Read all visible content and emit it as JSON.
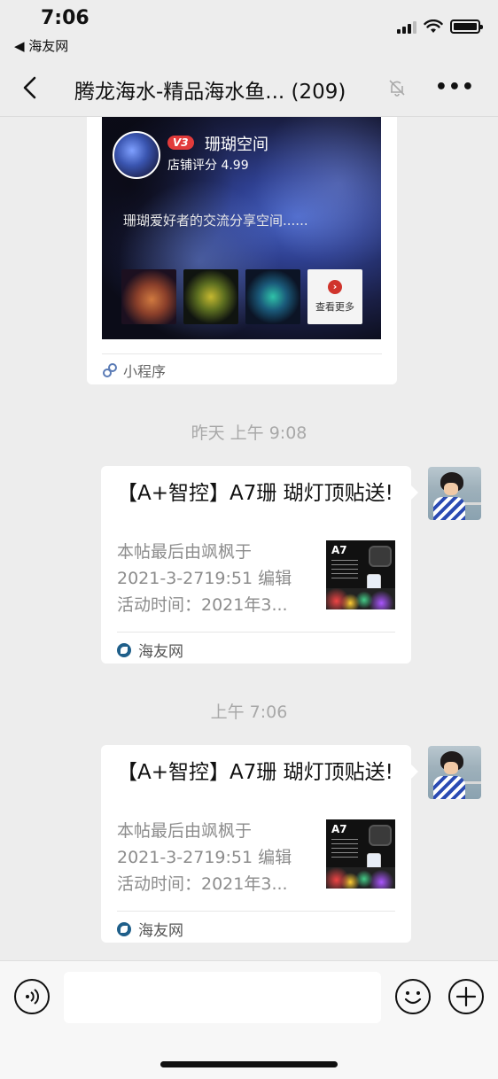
{
  "status_bar": {
    "time": "7:06",
    "back_app": "◀ 海友网"
  },
  "navbar": {
    "title": "腾龙海水-精品海水鱼... (209)",
    "more": "•••"
  },
  "mini_program_card": {
    "badge": "V3",
    "shop_name": "珊瑚空间",
    "shop_score": "店铺评分 4.99",
    "description": "珊瑚爱好者的交流分享空间......",
    "more_label": "查看更多",
    "footer_label": "小程序"
  },
  "timestamps": [
    "昨天 上午 9:08",
    "上午 7:06"
  ],
  "messages": [
    {
      "title": "【A+智控】A7珊 瑚灯顶贴送!",
      "desc_lines": [
        "本帖最后由飒枫于",
        "2021-3-2719:51 编辑",
        "活动时间：2021年3..."
      ],
      "thumb_text": "A7",
      "source": "海友网"
    },
    {
      "title": "【A+智控】A7珊 瑚灯顶贴送!",
      "desc_lines": [
        "本帖最后由飒枫于",
        "2021-3-2719:51 编辑",
        "活动时间：2021年3..."
      ],
      "thumb_text": "A7",
      "source": "海友网"
    }
  ],
  "input_bar": {
    "placeholder": ""
  },
  "icons": {
    "back": "chevron-left-icon",
    "mute": "bell-slash-icon",
    "voice": "voice-icon",
    "emoji": "smiley-icon",
    "plus": "plus-icon",
    "mini_program": "mini-program-link-icon",
    "source": "haiyou-logo-icon"
  },
  "colors": {
    "background": "#ededed",
    "badge": "#e23b3b",
    "more_dot": "#d0342c"
  }
}
